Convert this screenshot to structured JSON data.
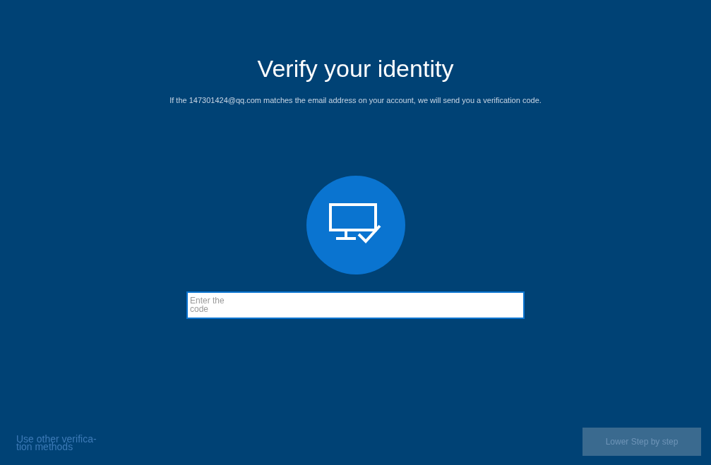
{
  "title": "Verify your identity",
  "message": "If the 147301424@qq.com matches the email address on your account, we will send you a verification code.",
  "code_field": {
    "placeholder": "Enter the code"
  },
  "other_methods_link": "Use other verifica-tion methods",
  "next_button": {
    "label": "Lower Step by step",
    "disabled": true
  }
}
